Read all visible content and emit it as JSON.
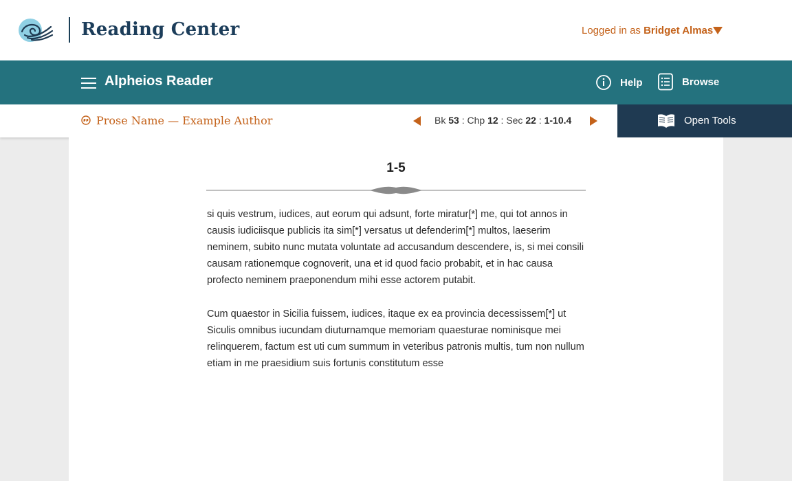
{
  "header": {
    "site_title": "Reading Center",
    "login_prefix": "Logged in as",
    "user_name": "Bridget Almas"
  },
  "nav": {
    "app_name": "Alpheios Reader",
    "help_label": "Help",
    "browse_label": "Browse"
  },
  "location": {
    "work_title": "Prose Name — Example Author",
    "book_label": "Bk",
    "book": "53",
    "chapter_label": "Chp",
    "chapter": "12",
    "section_label": "Sec",
    "section": "22",
    "range": "1-10.4",
    "separator": ":"
  },
  "tools": {
    "open_label": "Open Tools"
  },
  "content": {
    "heading": "1-5",
    "paragraphs": [
      "si quis vestrum, iudices, aut eorum qui adsunt, forte miratur[*] me, qui tot annos in causis iudiciisque publicis ita sim[*] versatus ut defenderim[*] multos, laeserim neminem, subito nunc mutata voluntate ad accusandum descendere, is, si mei consili causam rationemque cognoverit, una et id quod facio probabit, et in hac causa profecto neminem praeponendum mihi esse actorem putabit.",
      "Cum quaestor in Sicilia fuissem, iudices, itaque ex ea provincia decessissem[*] ut Siculis omnibus iucundam diuturnamque memoriam quaesturae nominisque mei relinquerem, factum est uti cum summum in veteribus patronis multis, tum non nullum etiam in me praesidium suis fortunis constitutum esse"
    ]
  },
  "colors": {
    "accent_orange": "#c4621a",
    "nav_teal": "#24727e",
    "tools_navy": "#1f3a52",
    "title_navy": "#1c3d5a"
  },
  "icons": {
    "logo": "reading-center-logo",
    "menu": "hamburger-icon",
    "help": "info-icon",
    "browse": "list-icon",
    "work": "quote-icon",
    "prev": "caret-left-icon",
    "next": "caret-right-icon",
    "tools": "open-book-icon",
    "user_menu": "caret-down-icon"
  }
}
